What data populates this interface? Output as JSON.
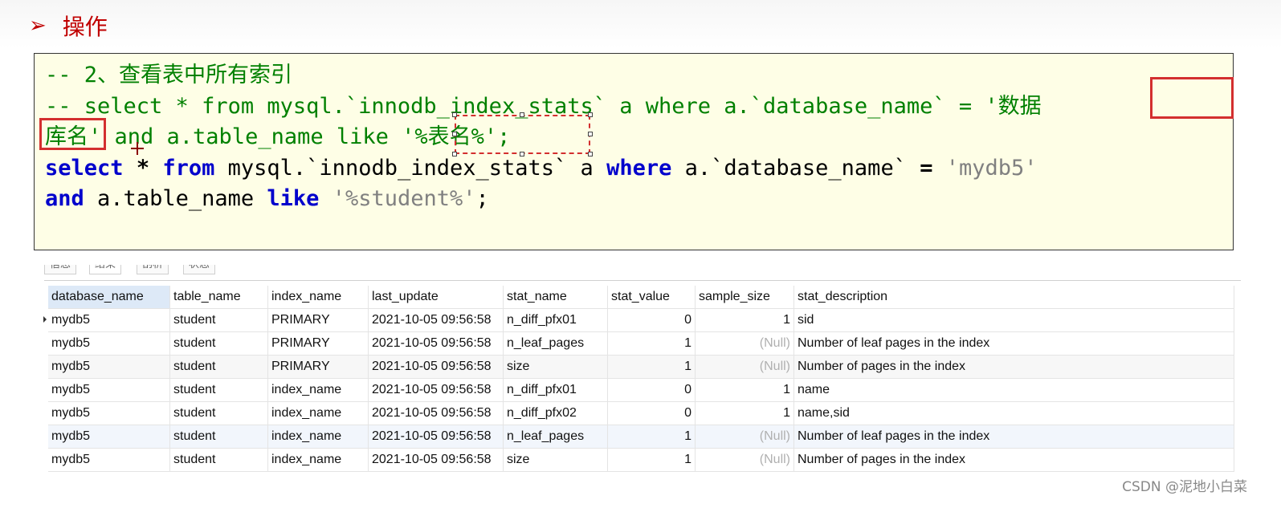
{
  "heading": {
    "arrow": "➢",
    "title": "操作"
  },
  "code": {
    "line1": "-- 2、查看表中所有索引",
    "line2": "-- select * from mysql.`innodb_index_stats` a where a.`database_name` = '数据",
    "line3": "库名' and a.table_name like '%表名%';",
    "line4_kw1": "select",
    "line4_star": "*",
    "line4_kw2": "from",
    "line4_mid": "mysql.`innodb_index_stats` a",
    "line4_kw3": "where",
    "line4_col": "a.`database_name`",
    "line4_eq": "=",
    "line4_str": "'mydb5'",
    "line5_kw1": "and",
    "line5_mid": "a.table_name",
    "line5_kw2": "like",
    "line5_str": "'%student%'",
    "line5_end": ";"
  },
  "tabs": [
    "信息",
    "结果",
    "剖析",
    "状态"
  ],
  "table": {
    "columns": [
      "database_name",
      "table_name",
      "index_name",
      "last_update",
      "stat_name",
      "stat_value",
      "sample_size",
      "stat_description"
    ],
    "rows": [
      [
        "mydb5",
        "student",
        "PRIMARY",
        "2021-10-05 09:56:58",
        "n_diff_pfx01",
        "0",
        "1",
        "sid"
      ],
      [
        "mydb5",
        "student",
        "PRIMARY",
        "2021-10-05 09:56:58",
        "n_leaf_pages",
        "1",
        "(Null)",
        "Number of leaf pages in the index"
      ],
      [
        "mydb5",
        "student",
        "PRIMARY",
        "2021-10-05 09:56:58",
        "size",
        "1",
        "(Null)",
        "Number of pages in the index"
      ],
      [
        "mydb5",
        "student",
        "index_name",
        "2021-10-05 09:56:58",
        "n_diff_pfx01",
        "0",
        "1",
        "name"
      ],
      [
        "mydb5",
        "student",
        "index_name",
        "2021-10-05 09:56:58",
        "n_diff_pfx02",
        "0",
        "1",
        "name,sid"
      ],
      [
        "mydb5",
        "student",
        "index_name",
        "2021-10-05 09:56:58",
        "n_leaf_pages",
        "1",
        "(Null)",
        "Number of leaf pages in the index"
      ],
      [
        "mydb5",
        "student",
        "index_name",
        "2021-10-05 09:56:58",
        "size",
        "1",
        "(Null)",
        "Number of pages in the index"
      ]
    ]
  },
  "watermark": "CSDN @泥地小白菜",
  "colors": {
    "comment": "#008000",
    "keyword": "#0000cc",
    "string": "#808080",
    "highlight": "#d32f2f",
    "heading": "#c00000"
  }
}
